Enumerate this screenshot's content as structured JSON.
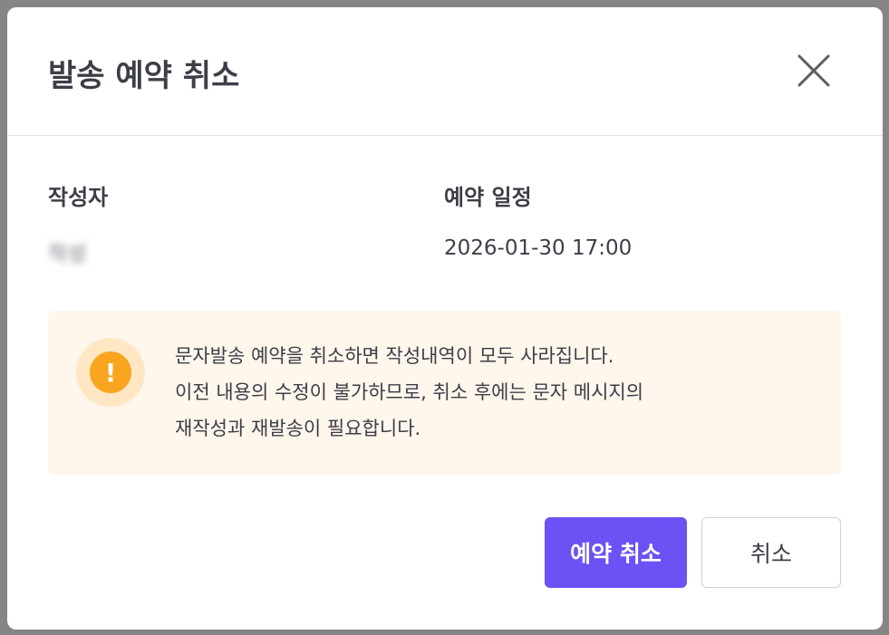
{
  "dialog": {
    "title": "발송 예약 취소",
    "close_icon": "close-icon"
  },
  "info": {
    "author_label": "작성자",
    "author_value": "작성",
    "schedule_label": "예약 일정",
    "schedule_value": "2026-01-30 17:00"
  },
  "notice": {
    "icon": "warning-icon",
    "icon_glyph": "!",
    "line1": "문자발송 예약을 취소하면 작성내역이 모두 사라집니다.",
    "line2": "이전 내용의 수정이 불가하므로, 취소 후에는 문자 메시지의",
    "line3": "재작성과 재발송이 필요합니다."
  },
  "actions": {
    "confirm_label": "예약 취소",
    "cancel_label": "취소"
  },
  "colors": {
    "primary": "#6a52f5",
    "warning": "#f9a51f",
    "notice_bg": "#fff6ec"
  }
}
